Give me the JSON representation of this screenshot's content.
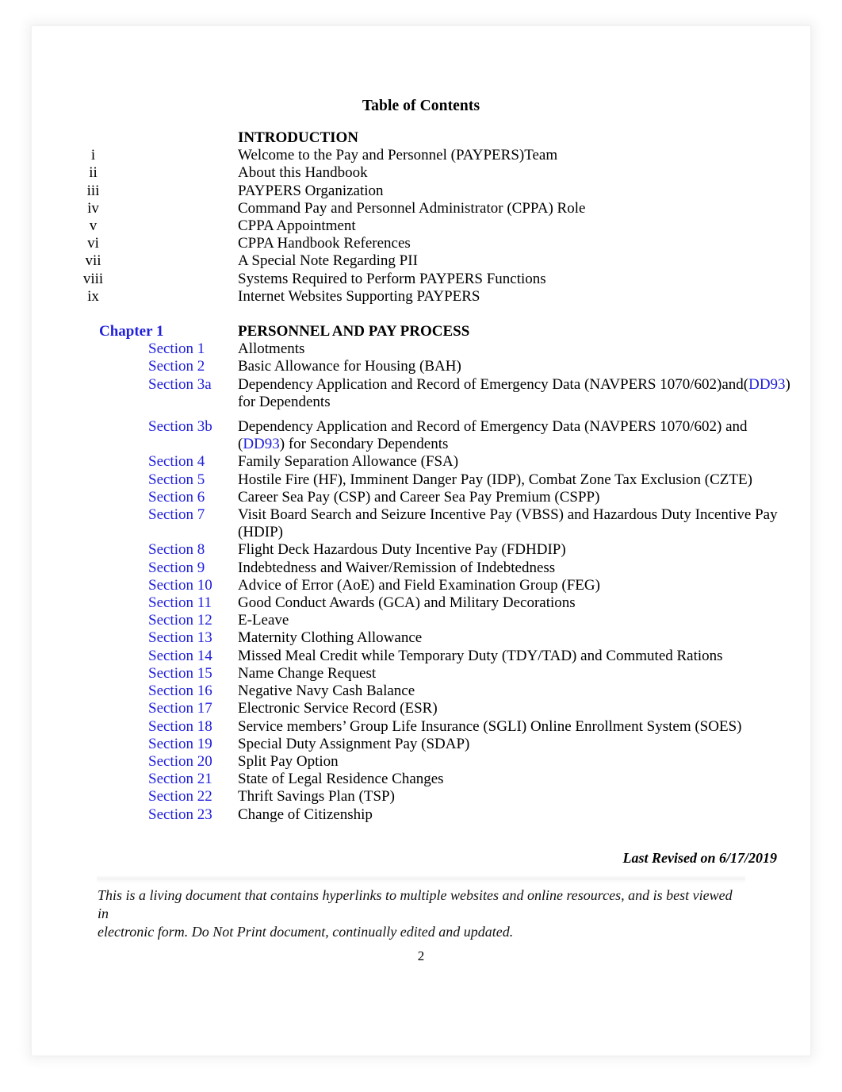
{
  "document": {
    "title": "Table of Contents",
    "page_number": "2",
    "last_revised": "Last Revised on 6/17/2019",
    "footnote_line1": "This is a living document that contains hyperlinks to multiple websites and online resources, and is best viewed in",
    "footnote_line2": "electronic form.  Do Not Print document, continually edited and updated.",
    "link_color": "#2020dd",
    "text_color": "#000000"
  },
  "intro": {
    "heading_label": "",
    "heading": "INTRODUCTION",
    "items": [
      {
        "label": "i",
        "text": "Welcome to the Pay and Personnel (PAYPERS)Team"
      },
      {
        "label": "ii",
        "text": "About this Handbook"
      },
      {
        "label": "iii",
        "text": "PAYPERS Organization"
      },
      {
        "label": "iv",
        "text": "Command Pay and Personnel Administrator (CPPA) Role"
      },
      {
        "label": "v",
        "text": "CPPA Appointment"
      },
      {
        "label": "vi",
        "text": "CPPA Handbook References"
      },
      {
        "label": "vii",
        "text": "A Special Note Regarding PII"
      },
      {
        "label": "viii",
        "text": "Systems Required to Perform PAYPERS Functions"
      },
      {
        "label": "ix",
        "text": "Internet Websites Supporting PAYPERS"
      }
    ]
  },
  "chapter1": {
    "label": "Chapter 1",
    "heading": "PERSONNEL AND PAY PROCESS",
    "sections": [
      {
        "label": "Section 1",
        "text": "Allotments"
      },
      {
        "label": "Section 2",
        "text": "Basic Allowance for Housing (BAH)"
      },
      {
        "label": "Section 3a",
        "text_part1": "Dependency Application and Record of Emergency Data (NAVPERS 1070/602)and(",
        "link": "DD93",
        "text_part2": ") for Dependents"
      },
      {
        "label": "Section 3b",
        "text_part1": "Dependency Application and Record of Emergency Data (NAVPERS 1070/602) and (",
        "link": "DD93",
        "text_part2": ") for Secondary Dependents"
      },
      {
        "label": "Section 4",
        "text": "Family Separation Allowance (FSA)"
      },
      {
        "label": "Section 5",
        "text": "Hostile Fire (HF), Imminent Danger Pay (IDP), Combat Zone Tax Exclusion (CZTE)"
      },
      {
        "label": "Section 6",
        "text": "Career Sea Pay (CSP) and Career Sea Pay Premium (CSPP)"
      },
      {
        "label": "Section 7",
        "text": "Visit Board Search and Seizure Incentive Pay (VBSS) and Hazardous Duty Incentive Pay (HDIP)"
      },
      {
        "label": "Section 8",
        "text": "Flight Deck Hazardous Duty Incentive Pay (FDHDIP)"
      },
      {
        "label": "Section 9",
        "text": "Indebtedness and Waiver/Remission of Indebtedness"
      },
      {
        "label": "Section 10",
        "text": "Advice of Error (AoE) and Field Examination Group (FEG)"
      },
      {
        "label": "Section 11",
        "text": "Good Conduct Awards (GCA) and Military Decorations"
      },
      {
        "label": "Section 12",
        "text": "E-Leave"
      },
      {
        "label": "Section 13",
        "text": "Maternity Clothing Allowance"
      },
      {
        "label": "Section 14",
        "text": "Missed Meal Credit while Temporary Duty (TDY/TAD) and Commuted Rations"
      },
      {
        "label": "Section 15",
        "text": "Name Change Request"
      },
      {
        "label": "Section 16",
        "text": "Negative Navy Cash Balance"
      },
      {
        "label": "Section 17",
        "text": "Electronic Service Record (ESR)"
      },
      {
        "label": "Section 18",
        "text": "Service members’ Group Life Insurance (SGLI) Online Enrollment System (SOES)"
      },
      {
        "label": "Section 19",
        "text": "Special Duty Assignment Pay (SDAP)"
      },
      {
        "label": "Section 20",
        "text": "Split Pay Option"
      },
      {
        "label": "Section 21",
        "text": "State of Legal Residence Changes"
      },
      {
        "label": "Section 22",
        "text": "Thrift Savings Plan (TSP)"
      },
      {
        "label": "Section 23",
        "text": "Change of Citizenship"
      }
    ]
  }
}
